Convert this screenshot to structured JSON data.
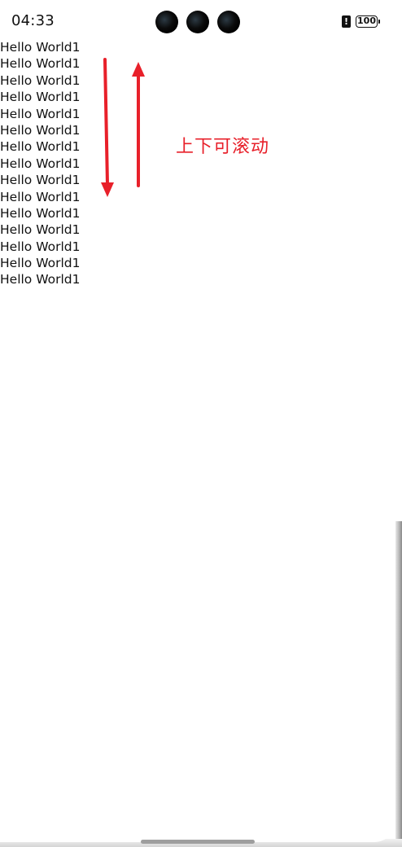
{
  "status_bar": {
    "time": "04:33",
    "battery_level": "100",
    "alert_icon": "!"
  },
  "list": {
    "items": [
      "Hello World1",
      "Hello World1",
      "Hello World1",
      "Hello World1",
      "Hello World1",
      "Hello World1",
      "Hello World1",
      "Hello World1",
      "Hello World1",
      "Hello World1",
      "Hello World1",
      "Hello World1",
      "Hello World1",
      "Hello World1",
      "Hello World1"
    ]
  },
  "annotation": {
    "hint_text": "上下可滚动",
    "color": "#e8202a",
    "icons": [
      "arrow-down-icon",
      "arrow-up-icon"
    ]
  }
}
